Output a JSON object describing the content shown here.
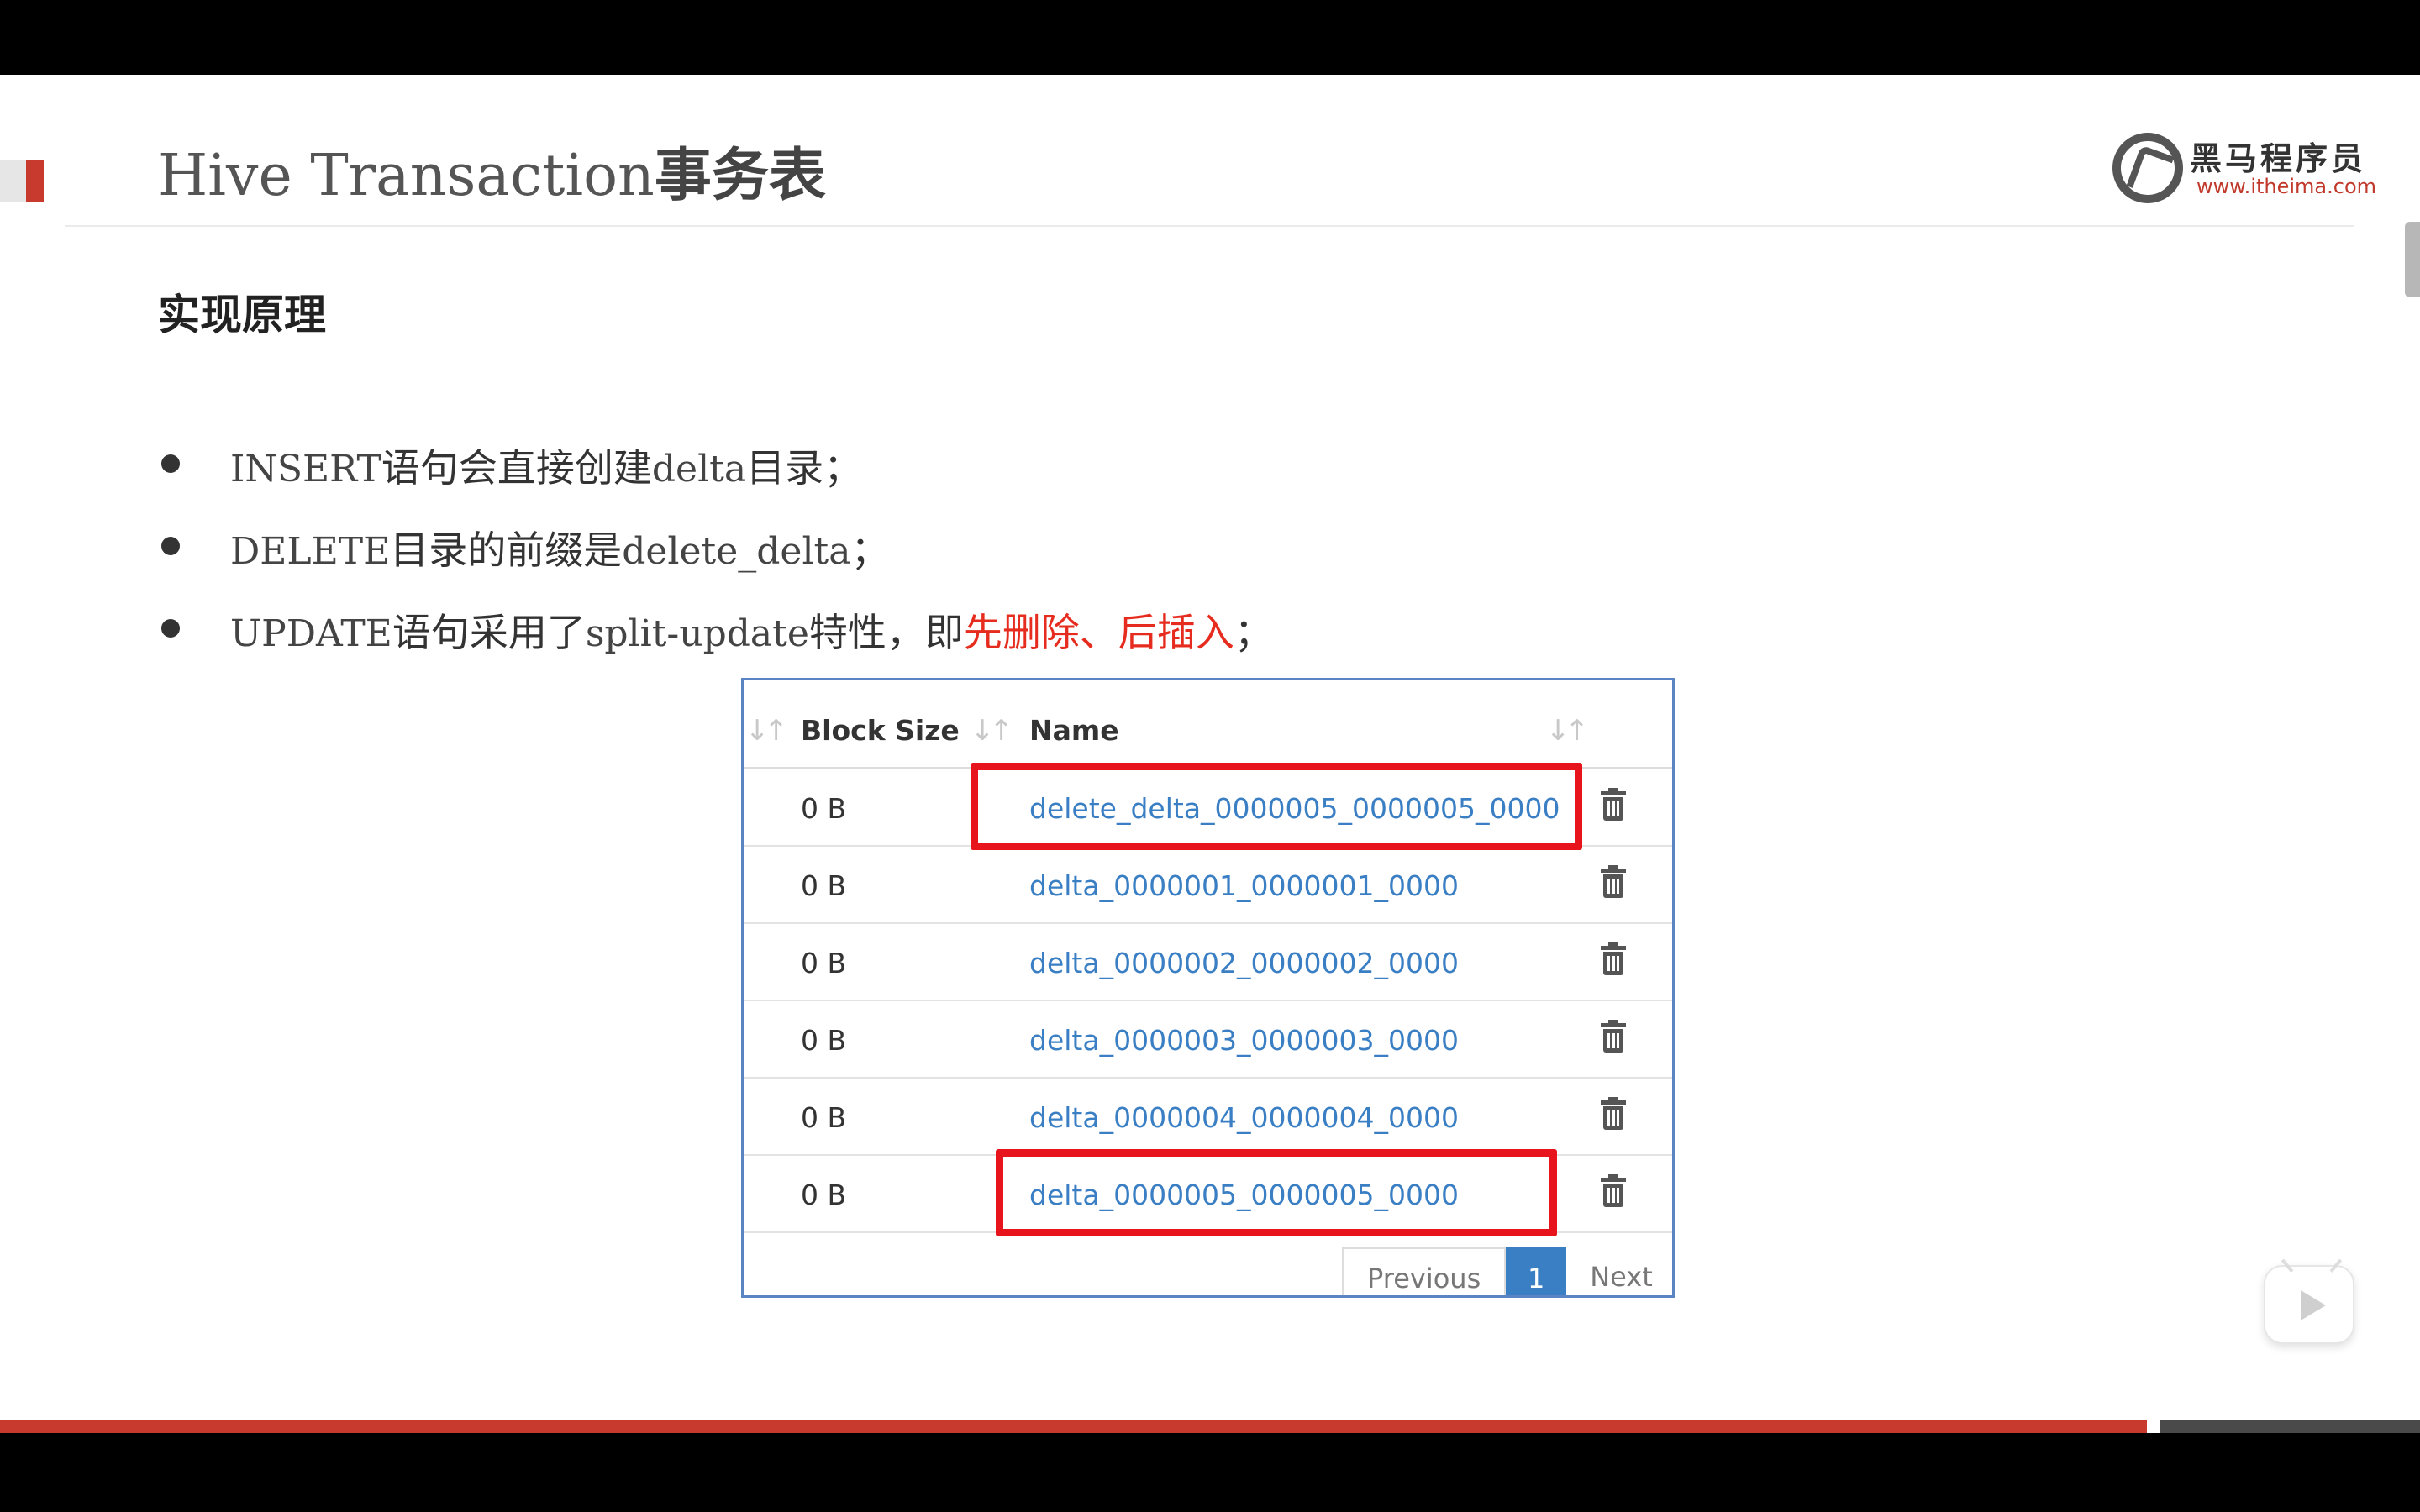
{
  "slide": {
    "title_prefix": "Hive Transaction",
    "title_suffix": "事务表",
    "section_heading": "实现原理",
    "logo_text": "黑马程序员",
    "logo_url": "www.itheima.com"
  },
  "bullets": [
    {
      "parts": [
        {
          "t": "INSERT",
          "mono": true
        },
        {
          "t": "语句会直接创建"
        },
        {
          "t": "delta",
          "mono": true
        },
        {
          "t": "目录；"
        }
      ]
    },
    {
      "parts": [
        {
          "t": "DELETE",
          "mono": true
        },
        {
          "t": "目录的前缀是"
        },
        {
          "t": "delete_delta",
          "mono": true
        },
        {
          "t": "；"
        }
      ]
    },
    {
      "parts": [
        {
          "t": "UPDATE",
          "mono": true
        },
        {
          "t": "语句采用了"
        },
        {
          "t": "split-update",
          "mono": true
        },
        {
          "t": "特性，即"
        },
        {
          "t": "先删除、后插入",
          "hl": true
        },
        {
          "t": "；"
        }
      ]
    }
  ],
  "table": {
    "col_block_size": "Block Size",
    "col_name": "Name",
    "rows": [
      {
        "size": "0 B",
        "name": "delete_delta_0000005_0000005_0000",
        "highlighted": true
      },
      {
        "size": "0 B",
        "name": "delta_0000001_0000001_0000",
        "highlighted": false
      },
      {
        "size": "0 B",
        "name": "delta_0000002_0000002_0000",
        "highlighted": false
      },
      {
        "size": "0 B",
        "name": "delta_0000003_0000003_0000",
        "highlighted": false
      },
      {
        "size": "0 B",
        "name": "delta_0000004_0000004_0000",
        "highlighted": false
      },
      {
        "size": "0 B",
        "name": "delta_0000005_0000005_0000",
        "highlighted": true
      }
    ],
    "pager": {
      "previous": "Previous",
      "current": "1",
      "next": "Next"
    }
  },
  "colors": {
    "accent_red": "#c8392e",
    "highlight_red": "#e8141c",
    "link_blue": "#3a7fc4",
    "emphasis_red": "#e62c1e"
  }
}
